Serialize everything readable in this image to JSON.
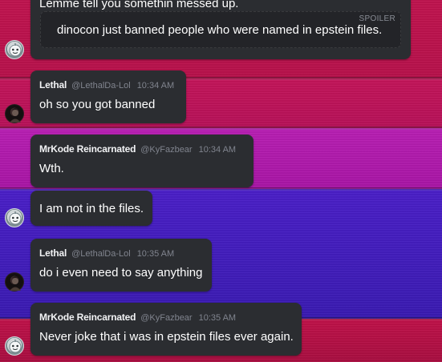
{
  "messages": [
    {
      "id": "m0",
      "partial_text": "Lemme tell you somethin messed up.",
      "spoiler": {
        "tag": "SPOILER",
        "text": "dinocon just banned people who were named in epstein files."
      }
    },
    {
      "id": "m1",
      "author": "Lethal",
      "handle": "@LethalDa-Lol",
      "time": "10:34 AM",
      "text": "oh so you got banned"
    },
    {
      "id": "m2",
      "author": "MrKode Reincarnated",
      "handle": "@KyFazbear",
      "time": "10:34 AM",
      "text": "Wth."
    },
    {
      "id": "m3",
      "text": "I am not in the files."
    },
    {
      "id": "m4",
      "author": "Lethal",
      "handle": "@LethalDa-Lol",
      "time": "10:35 AM",
      "text": "do i even need to say anything"
    },
    {
      "id": "m5",
      "author": "MrKode Reincarnated",
      "handle": "@KyFazbear",
      "time": "10:35 AM",
      "text": "Never joke that i was in epstein files ever again."
    }
  ],
  "avatars": {
    "kode": "robot-face-avatar",
    "lethal": "dark-character-avatar"
  }
}
